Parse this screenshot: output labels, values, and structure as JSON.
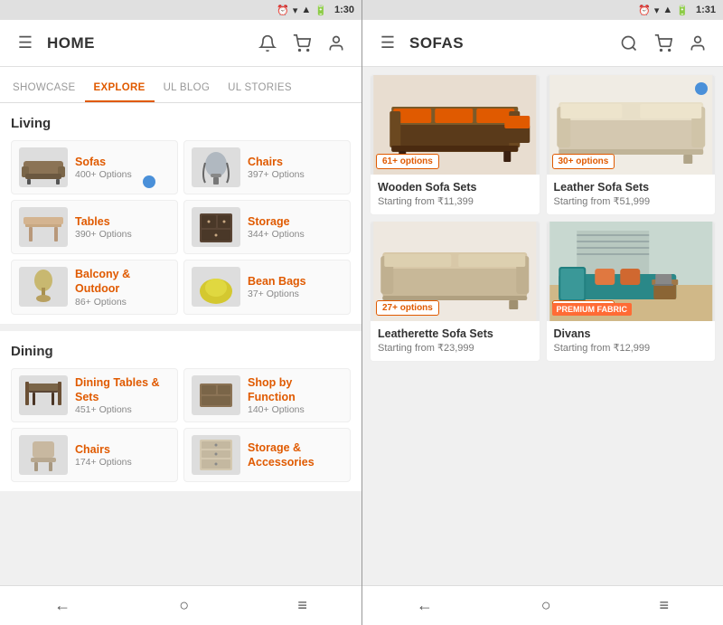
{
  "left": {
    "status": {
      "time": "1:30",
      "icons": [
        "alarm",
        "wifi",
        "signal",
        "battery"
      ]
    },
    "header": {
      "menu_icon": "☰",
      "title": "HOME",
      "bell_icon": "🔔",
      "cart_icon": "🛒",
      "user_icon": "👤"
    },
    "tabs": [
      {
        "id": "showcase",
        "label": "SHOWCASE",
        "active": false
      },
      {
        "id": "explore",
        "label": "EXPLORE",
        "active": true
      },
      {
        "id": "ulblog",
        "label": "UL BLOG",
        "active": false
      },
      {
        "id": "ulstories",
        "label": "UL STORIES",
        "active": false
      }
    ],
    "sections": [
      {
        "title": "Living",
        "items": [
          {
            "name": "Sofas",
            "count": "400+ Options",
            "has_dot": true
          },
          {
            "name": "Chairs",
            "count": "397+ Options",
            "has_dot": false
          },
          {
            "name": "Tables",
            "count": "390+ Options",
            "has_dot": false
          },
          {
            "name": "Storage",
            "count": "344+ Options",
            "has_dot": false
          },
          {
            "name": "Balcony & Outdoor",
            "count": "86+ Options",
            "has_dot": false
          },
          {
            "name": "Bean Bags",
            "count": "37+ Options",
            "has_dot": false
          }
        ]
      },
      {
        "title": "Dining",
        "items": [
          {
            "name": "Dining Tables & Sets",
            "count": "451+ Options",
            "has_dot": false
          },
          {
            "name": "Shop by Function",
            "count": "140+ Options",
            "has_dot": false
          },
          {
            "name": "Chairs",
            "count": "174+ Options",
            "has_dot": false
          },
          {
            "name": "Storage & Accessories",
            "count": "",
            "has_dot": false
          }
        ]
      }
    ],
    "bottom_nav": [
      "←",
      "○",
      "≡"
    ]
  },
  "right": {
    "status": {
      "time": "1:31"
    },
    "header": {
      "menu_icon": "☰",
      "title": "SOFAS",
      "search_icon": "🔍",
      "cart_icon": "🛒",
      "user_icon": "👤"
    },
    "products": [
      {
        "name": "Wooden Sofa Sets",
        "price": "Starting from ₹11,399",
        "options": "61+ options",
        "has_dot": false,
        "color": "orange_sofa"
      },
      {
        "name": "Leather Sofa Sets",
        "price": "Starting from ₹51,999",
        "options": "30+ options",
        "has_dot": true,
        "color": "cream_sofa"
      },
      {
        "name": "Leatherette Sofa Sets",
        "price": "Starting from ₹23,999",
        "options": "27+ options",
        "has_dot": false,
        "color": "beige_sofa"
      },
      {
        "name": "Divans",
        "price": "Starting from ₹12,999",
        "options": "20+ options",
        "has_dot": false,
        "color": "teal_divan",
        "premium": "PREMIUM FABRIC"
      }
    ],
    "bottom_nav": [
      "←",
      "○",
      "≡"
    ]
  }
}
